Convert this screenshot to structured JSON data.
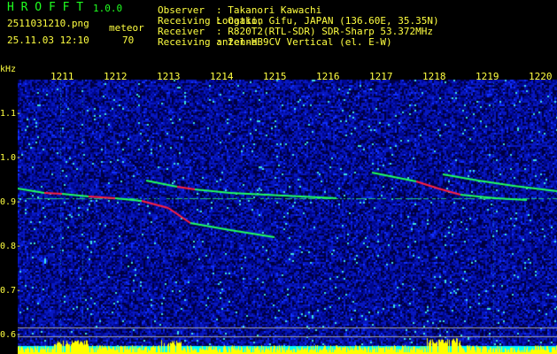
{
  "app": {
    "name": "H R O F F T",
    "version": "1.0.0"
  },
  "file": {
    "name": "2511031210.png",
    "datetime": "25.11.03 12:10"
  },
  "meteor": {
    "label": "meteor",
    "count": "70"
  },
  "info": [
    {
      "label": "Observer",
      "value": ": Takanori Kawachi"
    },
    {
      "label": "Receiving Location",
      "value": ": Ogaki, Gifu, JAPAN (136.60E, 35.35N)"
    },
    {
      "label": "Receiver",
      "value": ": R820T2(RTL-SDR) SDR-Sharp 53.372MHz"
    },
    {
      "label": "Receiving antenna",
      "value": ": 2el-HB9CV Vertical (el. E-W)"
    }
  ],
  "chart_data": {
    "type": "heatmap",
    "ylabel": "kHz",
    "yticks": [
      "1.1",
      "1.0",
      "0.9",
      "0.8",
      "0.7",
      "0.6"
    ],
    "xticks": [
      "1211",
      "1212",
      "1213",
      "1214",
      "1215",
      "1216",
      "1217",
      "1218",
      "1219",
      "1220"
    ],
    "ylim": [
      0.57,
      1.19
    ],
    "carrier_khz": 0.91,
    "colors": {
      "background": "#000080",
      "trace": "#20ff60",
      "peak": "#ff2040",
      "histogram": "#ffff00",
      "hist_base": "#00ffff",
      "labels": "#ffff40"
    }
  }
}
